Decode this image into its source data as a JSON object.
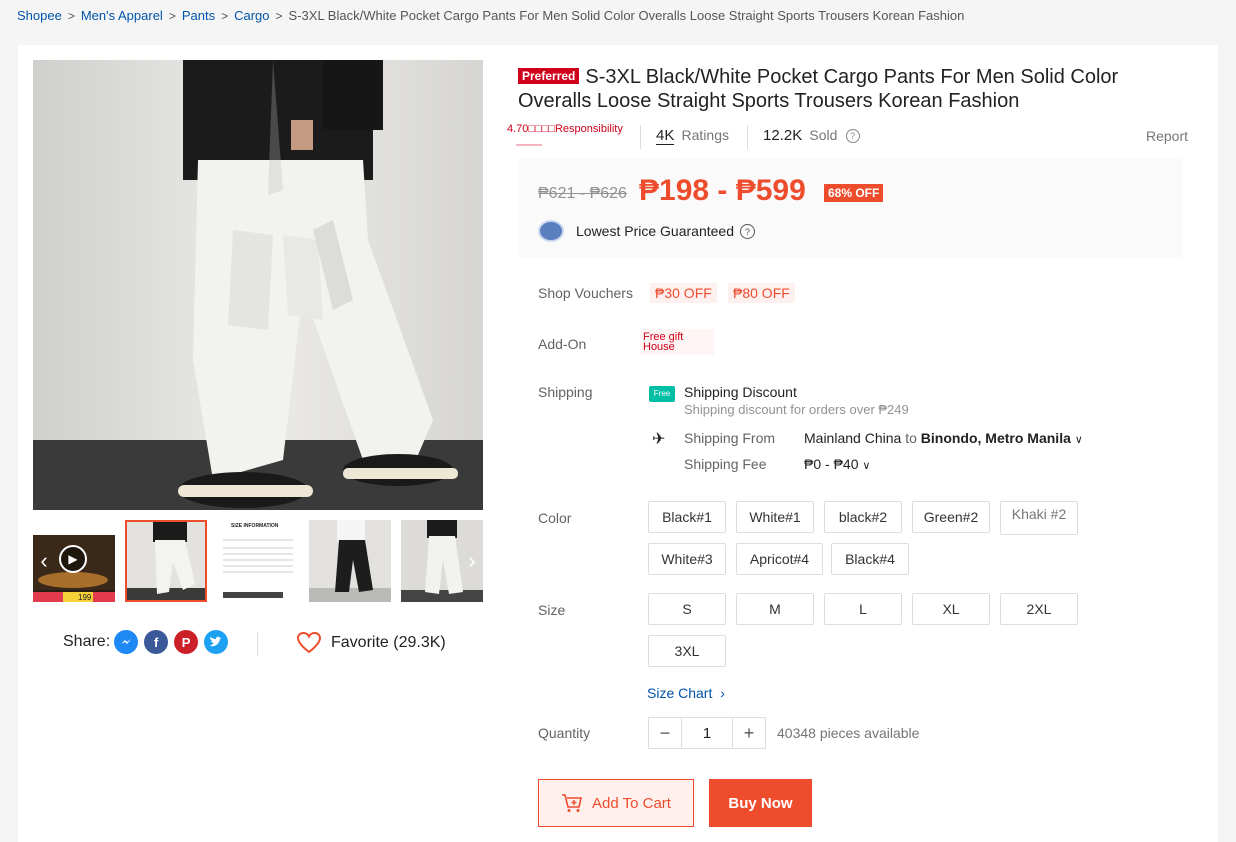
{
  "breadcrumb": {
    "items": [
      "Shopee",
      "Men's Apparel",
      "Pants",
      "Cargo"
    ],
    "current": "S-3XL Black/White Pocket Cargo Pants For Men Solid Color Overalls Loose Straight Sports Trousers Korean Fashion"
  },
  "product": {
    "badge": "Preferred",
    "title": "S-3XL Black/White Pocket Cargo Pants For Men Solid Color Overalls Loose Straight Sports Trousers Korean Fashion",
    "rating_text": "4.70□□□□Responsibility",
    "ratings_count": "4K",
    "ratings_label": "Ratings",
    "sold_count": "12.2K",
    "sold_label": "Sold",
    "report": "Report"
  },
  "price": {
    "original": "₱621 - ₱626",
    "current": "₱198 - ₱599",
    "discount": "68% OFF",
    "guarantee": "Lowest Price Guaranteed"
  },
  "vouchers": {
    "label": "Shop Vouchers",
    "items": [
      "₱30 OFF",
      "₱80 OFF"
    ]
  },
  "addon": {
    "label": "Add-On",
    "line1": "Free gift",
    "line2": "House"
  },
  "shipping": {
    "label": "Shipping",
    "discount_title": "Shipping Discount",
    "discount_sub": "Shipping discount for orders over ₱249",
    "from_label": "Shipping From",
    "from_value": "Mainland China",
    "to_word": "to",
    "to_value": "Binondo, Metro Manila",
    "fee_label": "Shipping Fee",
    "fee_value": "₱0 - ₱40",
    "free_tag": "Free"
  },
  "color": {
    "label": "Color",
    "options": [
      "Black#1",
      "White#1",
      "black#2",
      "Green#2",
      "Khaki #2",
      "White#3",
      "Apricot#4",
      "Black#4"
    ]
  },
  "size": {
    "label": "Size",
    "options": [
      "S",
      "M",
      "L",
      "XL",
      "2XL",
      "3XL"
    ],
    "chart_link": "Size Chart"
  },
  "quantity": {
    "label": "Quantity",
    "value": "1",
    "available": "40348 pieces available"
  },
  "actions": {
    "add_to_cart": "Add To Cart",
    "buy_now": "Buy Now"
  },
  "share": {
    "label": "Share:",
    "favorite": "Favorite (29.3K)"
  },
  "thumbnail": {
    "size_info_title": "SIZE INFORMATION",
    "promo_text": "199"
  },
  "colors": {
    "accent": "#ee4d2d",
    "link": "#0055aa",
    "preferred": "#d0011b",
    "shipping_green": "#00bfa5"
  },
  "icons": [
    "chevron-right-icon",
    "help-circle-icon",
    "guarantee-badge-icon",
    "free-shipping-truck-icon",
    "plane-icon",
    "chevron-down-icon",
    "messenger-icon",
    "facebook-icon",
    "pinterest-icon",
    "twitter-icon",
    "heart-icon",
    "cart-plus-icon",
    "play-icon",
    "minus-icon",
    "plus-icon"
  ]
}
